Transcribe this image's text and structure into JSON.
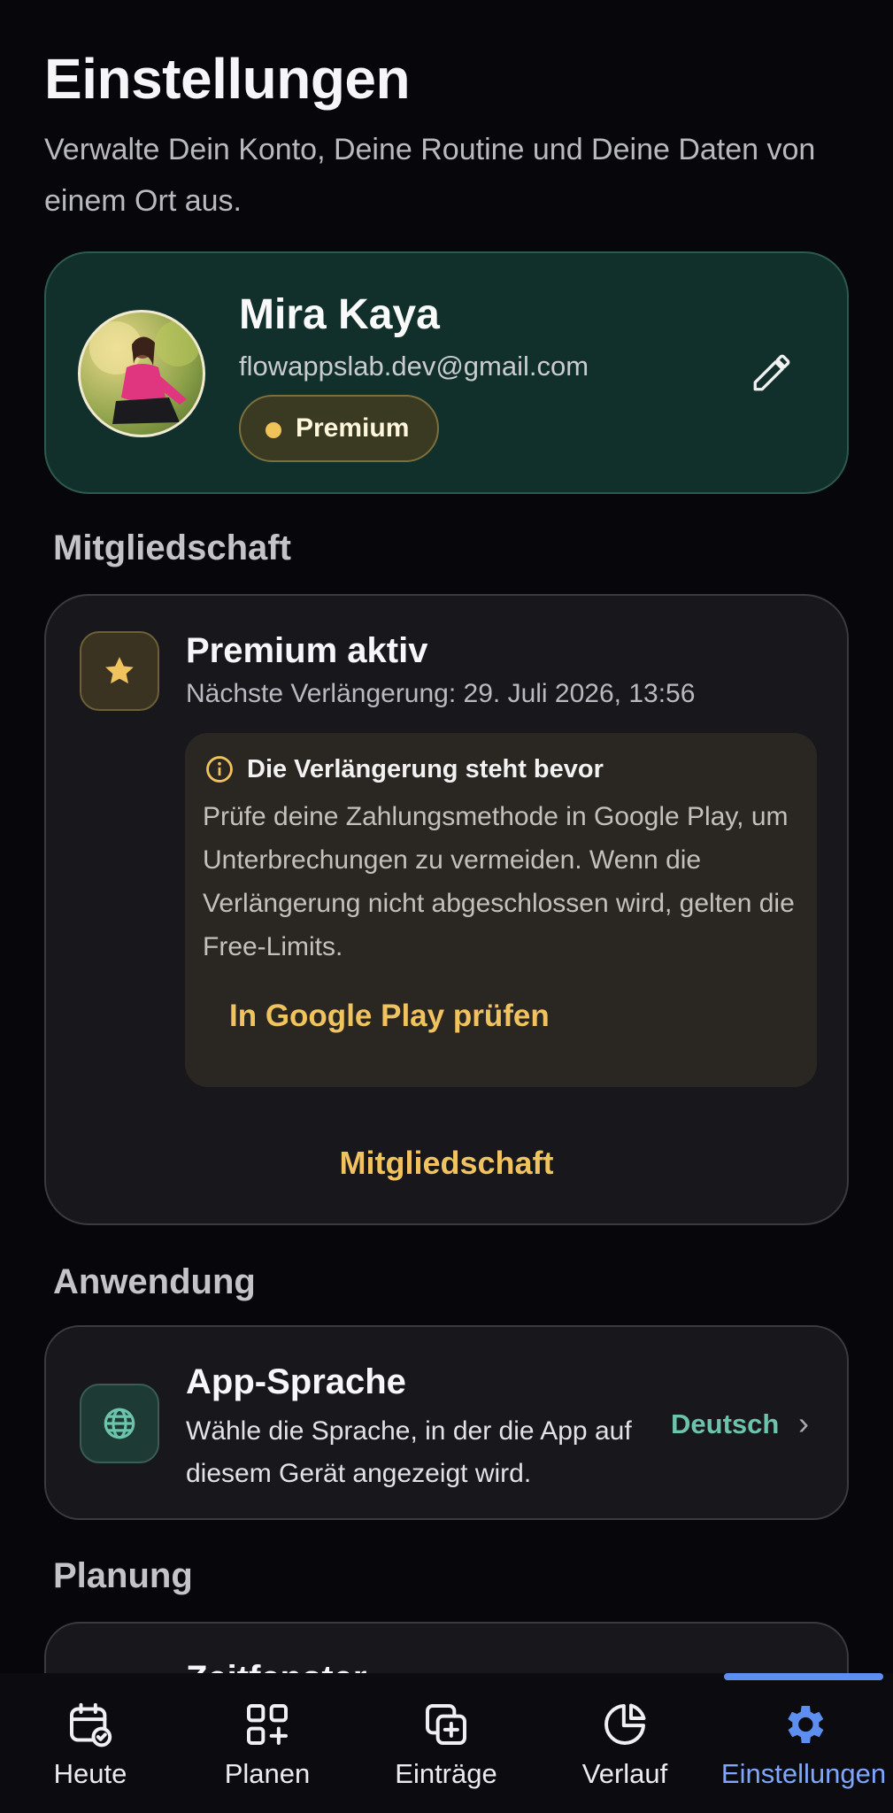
{
  "header": {
    "title": "Einstellungen",
    "subtitle": "Verwalte Dein Konto, Deine Routine und Deine Daten von einem Ort aus."
  },
  "profile": {
    "name": "Mira Kaya",
    "email": "flowappslab.dev@gmail.com",
    "badge": "Premium",
    "edit_icon": "pencil-icon"
  },
  "sections": {
    "membership": "Mitgliedschaft",
    "application": "Anwendung",
    "planning": "Planung"
  },
  "membership": {
    "title": "Premium aktiv",
    "next_renewal": "Nächste Verlängerung: 29. Juli 2026, 13:56",
    "notice": {
      "title": "Die Verlängerung steht bevor",
      "body": "Prüfe deine Zahlungsmethode in Google Play, um Unterbrechungen zu vermeiden. Wenn die Verlängerung nicht abgeschlossen wird, gelten die Free-Limits.",
      "action": "In Google Play prüfen"
    },
    "link": "Mitgliedschaft"
  },
  "app_language": {
    "title": "App-Sprache",
    "description": "Wähle die Sprache, in der die App auf diesem Gerät angezeigt wird.",
    "value": "Deutsch"
  },
  "planning": {
    "first_item_title": "Zeitfenster"
  },
  "nav": [
    {
      "label": "Heute",
      "icon": "calendar-check-icon"
    },
    {
      "label": "Planen",
      "icon": "grid-plus-icon"
    },
    {
      "label": "Einträge",
      "icon": "copy-plus-icon"
    },
    {
      "label": "Verlauf",
      "icon": "pie-chart-icon"
    },
    {
      "label": "Einstellungen",
      "icon": "gear-icon",
      "active": true
    }
  ],
  "colors": {
    "accent_gold": "#f1c35e",
    "accent_teal": "#6cc4ad",
    "accent_blue": "#7ea7ff",
    "profile_bg": "#12302b"
  }
}
